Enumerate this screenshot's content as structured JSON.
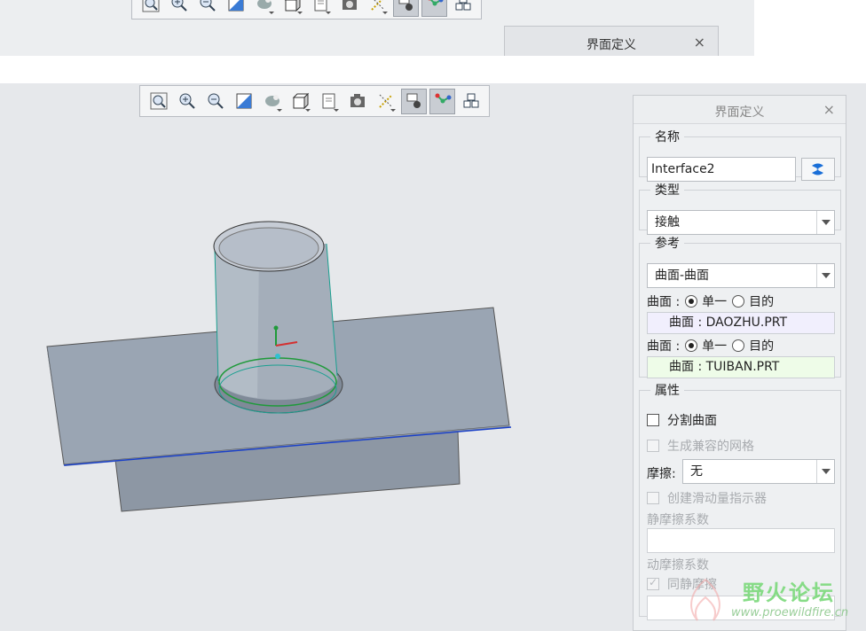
{
  "top_strip": {
    "panel_title": "界面定义",
    "close_glyph": "×"
  },
  "toolbar": {
    "buttons": [
      {
        "icon": "zoom-fit-icon"
      },
      {
        "icon": "zoom-in-icon"
      },
      {
        "icon": "zoom-out-icon"
      },
      {
        "icon": "repaint-icon"
      },
      {
        "icon": "orient-mode-icon"
      },
      {
        "icon": "display-style-icon"
      },
      {
        "icon": "saved-views-icon"
      },
      {
        "icon": "view-manager-icon"
      },
      {
        "icon": "datum-display-icon"
      },
      {
        "icon": "annotation-display-icon",
        "active": true
      },
      {
        "icon": "model-tree-display-icon",
        "active": true
      },
      {
        "icon": "spin-center-icon"
      }
    ]
  },
  "dialog": {
    "title": "界面定义",
    "close_glyph": "×",
    "name_group": {
      "legend": "名称",
      "value": "Interface2"
    },
    "type_group": {
      "legend": "类型",
      "selected": "接触"
    },
    "ref_group": {
      "legend": "参考",
      "selected": "曲面-曲面",
      "surface_label_1": "曲面 :",
      "single_1": "单一",
      "target_1": "目的",
      "ref_1": "曲面 : DAOZHU.PRT",
      "surface_label_2": "曲面 :",
      "single_2": "单一",
      "target_2": "目的",
      "ref_2": "曲面 : TUIBAN.PRT",
      "ref_1_color": "#f1effd",
      "ref_2_color": "#eefce8"
    },
    "props_group": {
      "legend": "属性",
      "split_surface": "分割曲面",
      "compatible_mesh": "生成兼容的网格",
      "friction_label": "摩擦:",
      "friction_value": "无",
      "slip_indicator": "创建滑动量指示器",
      "static_friction": "静摩擦系数",
      "dynamic_friction": "动摩擦系数",
      "same_friction": "同静摩擦"
    }
  },
  "watermark": {
    "text": "野火论坛",
    "url": "www.proewildfire.cn"
  },
  "colors": {
    "viewport_bg": "#e6e8eb",
    "model_body": "#9aa6b4",
    "edge_highlight": "#1a40c8",
    "selection_green": "#1f9a3a"
  }
}
